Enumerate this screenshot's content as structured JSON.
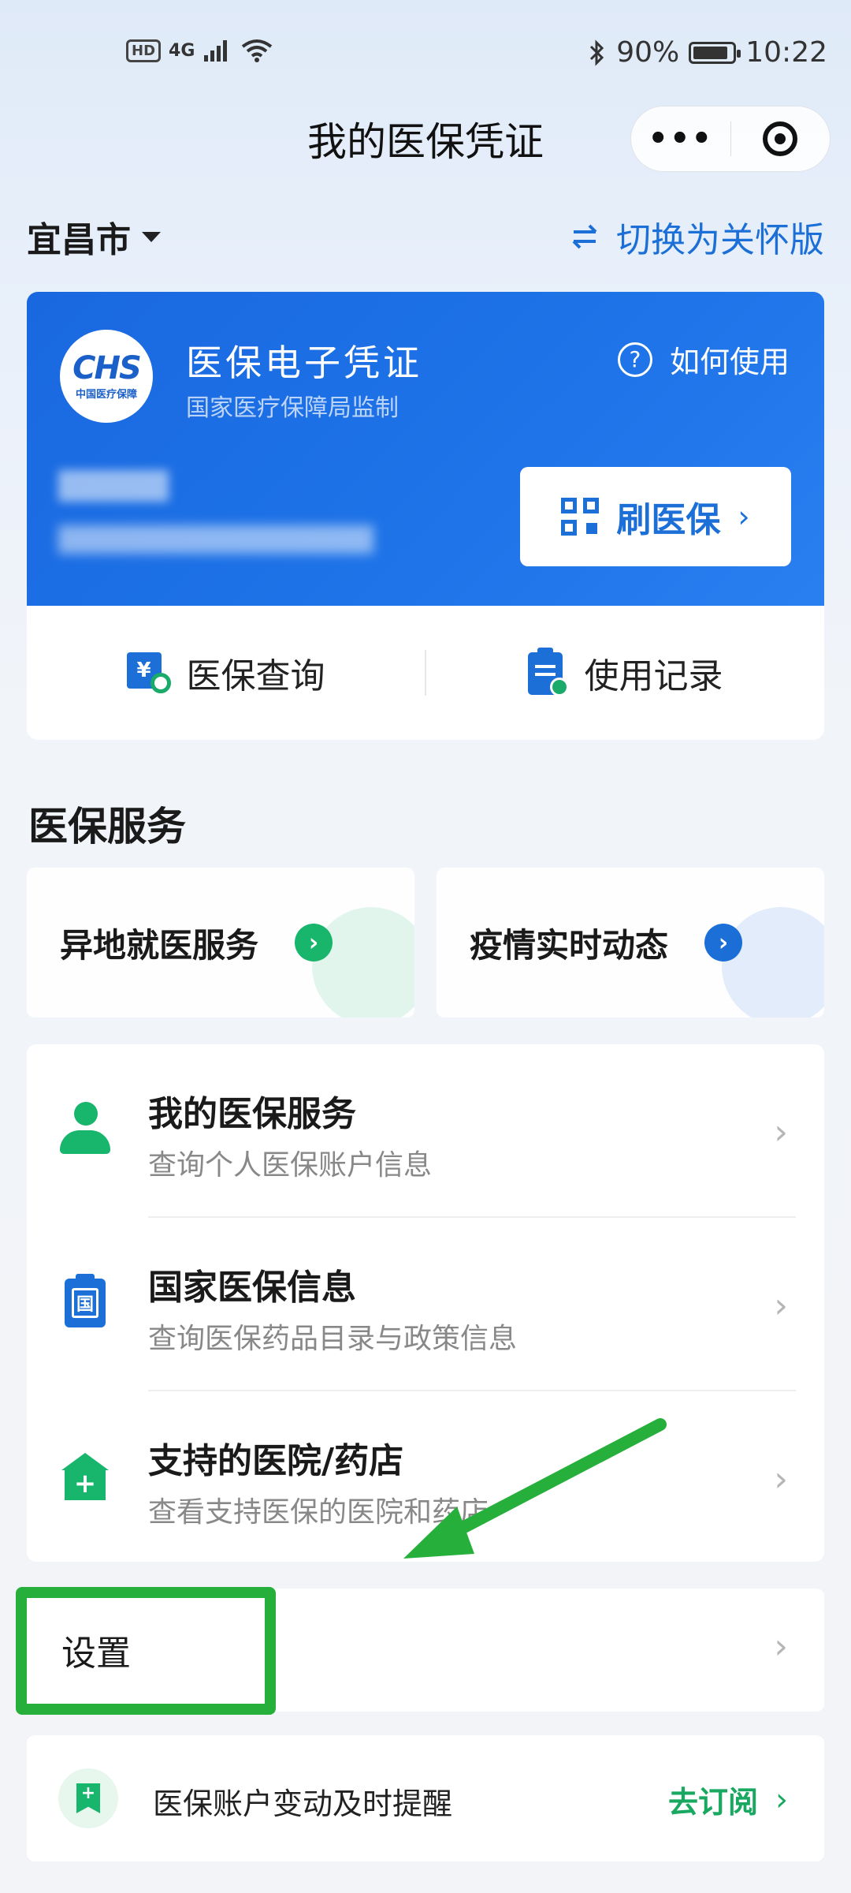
{
  "status_bar": {
    "hd": "HD",
    "network": "4G",
    "battery": "90%",
    "battery_level": 0.9,
    "time": "10:22"
  },
  "header": {
    "title": "我的医保凭证",
    "menu_icon": "more-dots-icon",
    "close_icon": "target-icon"
  },
  "city_row": {
    "city": "宜昌市",
    "switch_label": "切换为关怀版"
  },
  "card": {
    "logo_text": "CHS",
    "logo_sub": "中国医疗保障",
    "title": "医保电子凭证",
    "subtitle": "国家医疗保障局监制",
    "help_label": "如何使用",
    "scan_label": "刷医保",
    "actions": [
      {
        "label": "医保查询",
        "icon": "query-icon"
      },
      {
        "label": "使用记录",
        "icon": "record-icon"
      }
    ]
  },
  "services": {
    "section_title": "医保服务",
    "promos": [
      {
        "label": "异地就医服务",
        "color": "#18b56c"
      },
      {
        "label": "疫情实时动态",
        "color": "#1b6fd6"
      }
    ],
    "items": [
      {
        "title": "我的医保服务",
        "desc": "查询个人医保账户信息",
        "icon": "person-icon"
      },
      {
        "title": "国家医保信息",
        "desc": "查询医保药品目录与政策信息",
        "icon_text": "国"
      },
      {
        "title": "支持的医院/药店",
        "desc": "查看支持医保的医院和药店",
        "icon_text": "+"
      }
    ]
  },
  "settings": {
    "label": "设置"
  },
  "subscribe": {
    "text": "医保账户变动及时提醒",
    "action": "去订阅"
  },
  "colors": {
    "accent_blue": "#1b6fd6",
    "accent_green": "#18b56c",
    "highlight_green": "#26b03b"
  }
}
